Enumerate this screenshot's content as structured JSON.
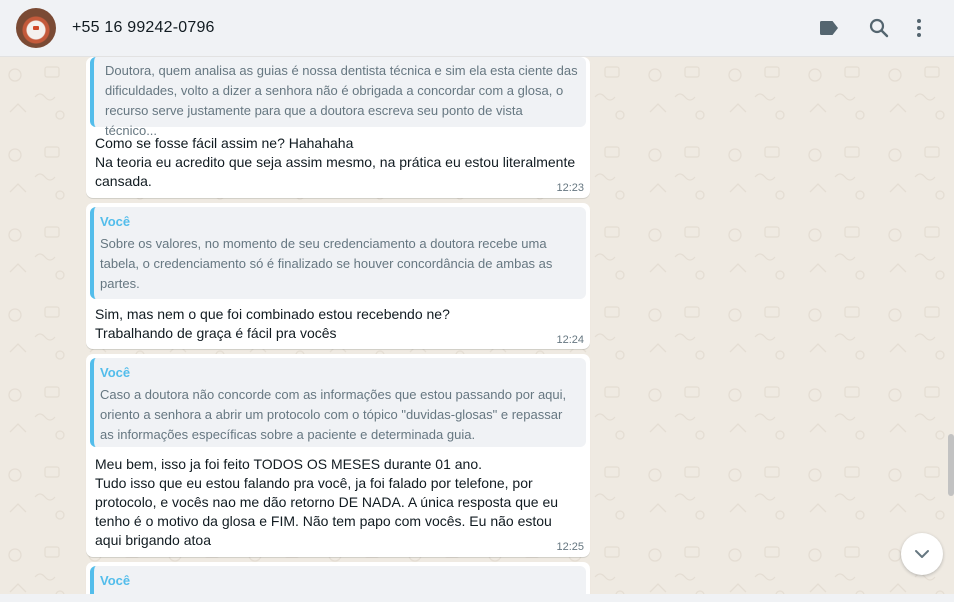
{
  "header": {
    "contact_name": "+55 16 99242-0796",
    "icons": [
      "label-icon",
      "search-icon",
      "menu-icon"
    ]
  },
  "messages": [
    {
      "quote_text": "Doutora, quem analisa as guias é nossa dentista técnica e sim ela esta ciente das dificuldades, volto a dizer a senhora não é obrigada a concordar com a glosa, o recurso serve justamente para que a doutora escreva seu ponto de vista técnico...",
      "text": "Como se fosse fácil assim ne? Hahahaha\nNa teoria eu acredito que seja assim mesmo, na prática eu estou literalmente cansada.",
      "time": "12:23"
    },
    {
      "quote_author": "Você",
      "quote_text": "Sobre os valores, no momento de seu credenciamento a doutora recebe uma tabela, o credenciamento só é finalizado se houver concordância de ambas as partes.",
      "text": "Sim, mas nem o que foi combinado estou recebendo ne?\nTrabalhando de graça é fácil pra vocês",
      "time": "12:24"
    },
    {
      "quote_author": "Você",
      "quote_text": "Caso a doutora não concorde com as informações que estou passando por aqui, oriento a senhora a abrir um protocolo com o tópico \"duvidas-glosas\" e repassar as informações específicas sobre a paciente e determinada guia.",
      "text": "Meu bem, isso ja foi feito TODOS OS MESES durante 01 ano.\nTudo isso que eu estou falando pra você, ja foi falado por telefone, por protocolo, e vocês nao me dão retorno DE NADA. A única resposta que eu tenho é o motivo da glosa e FIM. Não tem papo com vocês. Eu não estou aqui brigando atoa",
      "time": "12:25"
    },
    {
      "quote_author": "Você"
    }
  ],
  "colors": {
    "chat_background": "#efeae2",
    "quote_accent": "#53bdeb",
    "header_background": "#f0f2f5"
  }
}
